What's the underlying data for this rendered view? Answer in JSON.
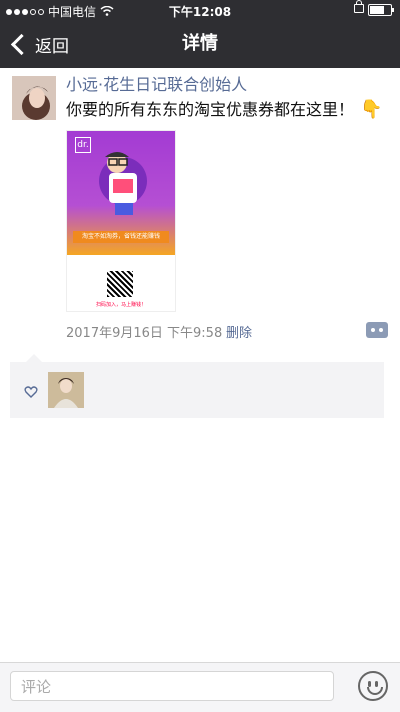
{
  "statusbar": {
    "carrier": "中国电信",
    "time": "下午12:08",
    "battery_level": 0.7
  },
  "navbar": {
    "back_label": "返回",
    "title": "详情"
  },
  "post": {
    "author": "小远·花生日记联合创始人",
    "text": "你要的所有东东的淘宝优惠券都在这里！",
    "emoji": "👇",
    "poster_caption": "扫码加入，马上赚钱！",
    "poster_tag": "淘宝不如淘券，省钱还能赚钱",
    "date": "2017年9月16日 下午9:58",
    "delete_label": "删除"
  },
  "comment_input": {
    "placeholder": "评论"
  },
  "colors": {
    "nav_bg": "#2e2e32",
    "link": "#576b95",
    "likes_bg": "#f3f3f5"
  }
}
